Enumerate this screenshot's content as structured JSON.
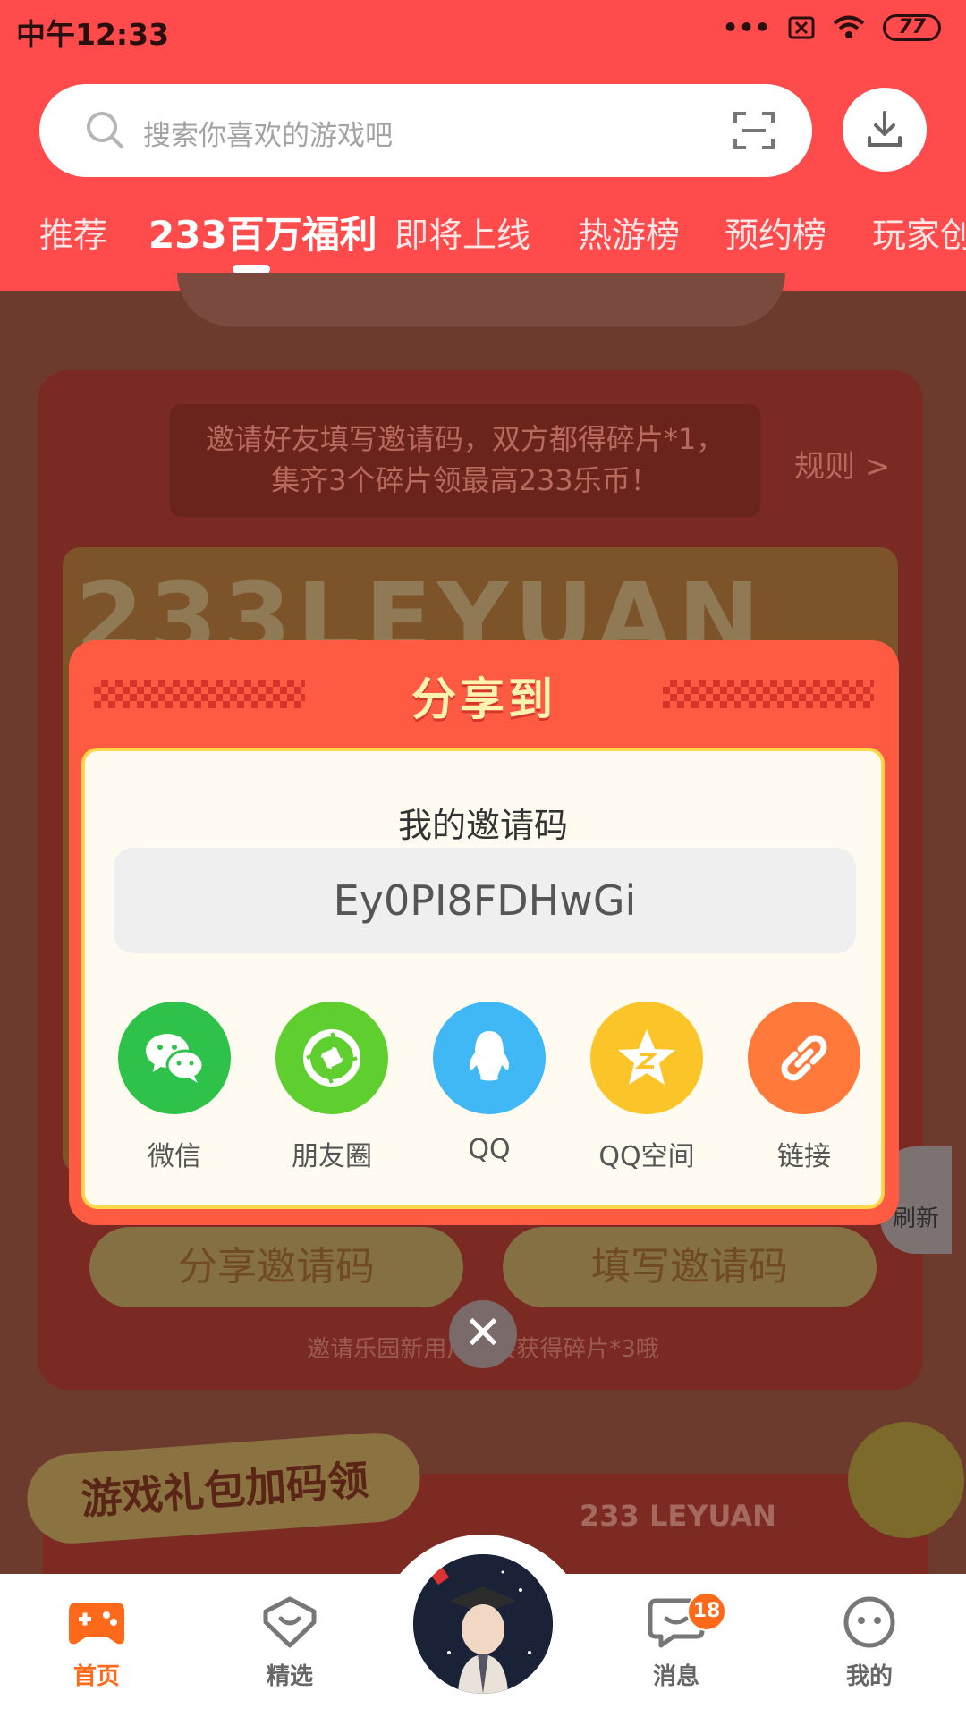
{
  "status_bar": {
    "time": "中午12:33",
    "battery": "77"
  },
  "search": {
    "placeholder": "搜索你喜欢的游戏吧"
  },
  "tabs": [
    "推荐",
    "233百万福利",
    "即将上线",
    "热游榜",
    "预约榜",
    "玩家创"
  ],
  "active_tab_index": 1,
  "background": {
    "invite_hint_line1": "邀请好友填写邀请码，双方都得碎片*1，",
    "invite_hint_line2": "集齐3个碎片领最高233乐币！",
    "rules_link": "规则 >",
    "frame_title": "233LEYUAN",
    "share_code_button": "分享邀请码",
    "fill_code_button": "填写邀请码",
    "sub_hint": "邀请乐园新用户直接获得碎片*3哦",
    "refresh_label": "刷新",
    "gift_section_title": "游戏礼包加码领",
    "gift_brand": "233 LEYUAN"
  },
  "share_modal": {
    "title": "分享到",
    "code_label": "我的邀请码",
    "invite_code": "Ey0PI8FDHwGi",
    "targets": [
      {
        "label": "微信",
        "icon": "wechat-icon",
        "color": "#2ec24b"
      },
      {
        "label": "朋友圈",
        "icon": "moments-icon",
        "color": "#5fcf2f"
      },
      {
        "label": "QQ",
        "icon": "qq-icon",
        "color": "#3fb8f5"
      },
      {
        "label": "QQ空间",
        "icon": "qzone-icon",
        "color": "#fbc52a"
      },
      {
        "label": "链接",
        "icon": "link-icon",
        "color": "#ff7a3a"
      }
    ]
  },
  "bottom_nav": {
    "items": [
      {
        "label": "首页",
        "icon": "gamepad-icon"
      },
      {
        "label": "精选",
        "icon": "heart-badge-icon"
      },
      {
        "label": "消息",
        "icon": "chat-icon"
      },
      {
        "label": "我的",
        "icon": "face-icon"
      }
    ],
    "message_badge": "18"
  },
  "colors": {
    "brand": "#ff4b4b",
    "accent": "#ff6a1a"
  }
}
